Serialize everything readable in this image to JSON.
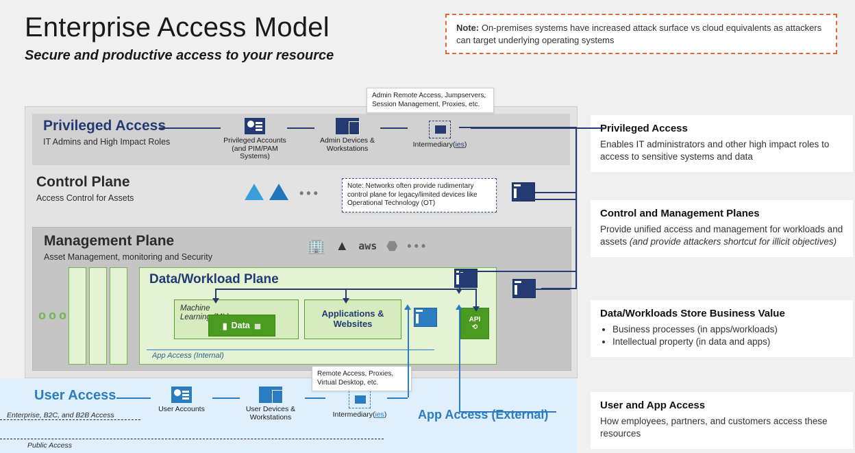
{
  "header": {
    "title": "Enterprise Access Model",
    "subtitle": "Secure and productive access to your resource"
  },
  "top_note": {
    "label": "Note:",
    "text": "On-premises systems have increased attack surface vs cloud equivalents as attackers can target underlying operating systems"
  },
  "tiers": {
    "privileged": {
      "title": "Privileged Access",
      "sub": "IT Admins and High Impact Roles",
      "accounts_caption": "Privileged Accounts (and PIM/PAM Systems)",
      "devices_caption": "Admin Devices & Workstations",
      "intermediary_caption_prefix": "Intermediary(",
      "intermediary_caption_link": "ies",
      "intermediary_caption_suffix": ")",
      "callout": "Admin Remote Access, Jumpservers, Session Management, Proxies, etc."
    },
    "control": {
      "title": "Control Plane",
      "sub": "Access Control for Assets",
      "callout": "Note: Networks often provide rudimentary control plane for legacy/limited devices like Operational Technology (OT)"
    },
    "management": {
      "title": "Management Plane",
      "sub": "Asset Management, monitoring and Security",
      "provider_aws": "aws"
    },
    "data_workload": {
      "title": "Data/Workload Plane",
      "ml": "Machine Learning (ML)",
      "data_chip": "Data",
      "apps": "Applications & Websites",
      "api": "API",
      "app_access_internal_label": "App Access (Internal)"
    }
  },
  "user_access": {
    "title": "User Access",
    "enterprise_note": "Enterprise, B2C, and B2B Access",
    "public_note": "Public Access",
    "accounts_caption": "User Accounts",
    "devices_caption": "User Devices & Workstations",
    "intermediary_caption_prefix": "Intermediary(",
    "intermediary_caption_link": "ies",
    "intermediary_caption_suffix": ")",
    "callout": "Remote Access, Proxies, Virtual Desktop, etc.",
    "app_access_external": "App Access (External)"
  },
  "right": {
    "privileged": {
      "heading": "Privileged Access",
      "body": "Enables IT administrators and other high impact roles to access to sensitive systems and data"
    },
    "control_mgmt": {
      "heading": "Control and Management Planes",
      "body_pre": "Provide unified access and management for workloads and assets ",
      "body_em": "(and provide attackers shortcut for illicit objectives)"
    },
    "data": {
      "heading": "Data/Workloads Store Business Value",
      "b1": "Business processes (in apps/workloads)",
      "b2": "Intellectual property (in data and apps)"
    },
    "user": {
      "heading": "User and App Access",
      "body": "How employees, partners, and customers access these resources"
    }
  }
}
